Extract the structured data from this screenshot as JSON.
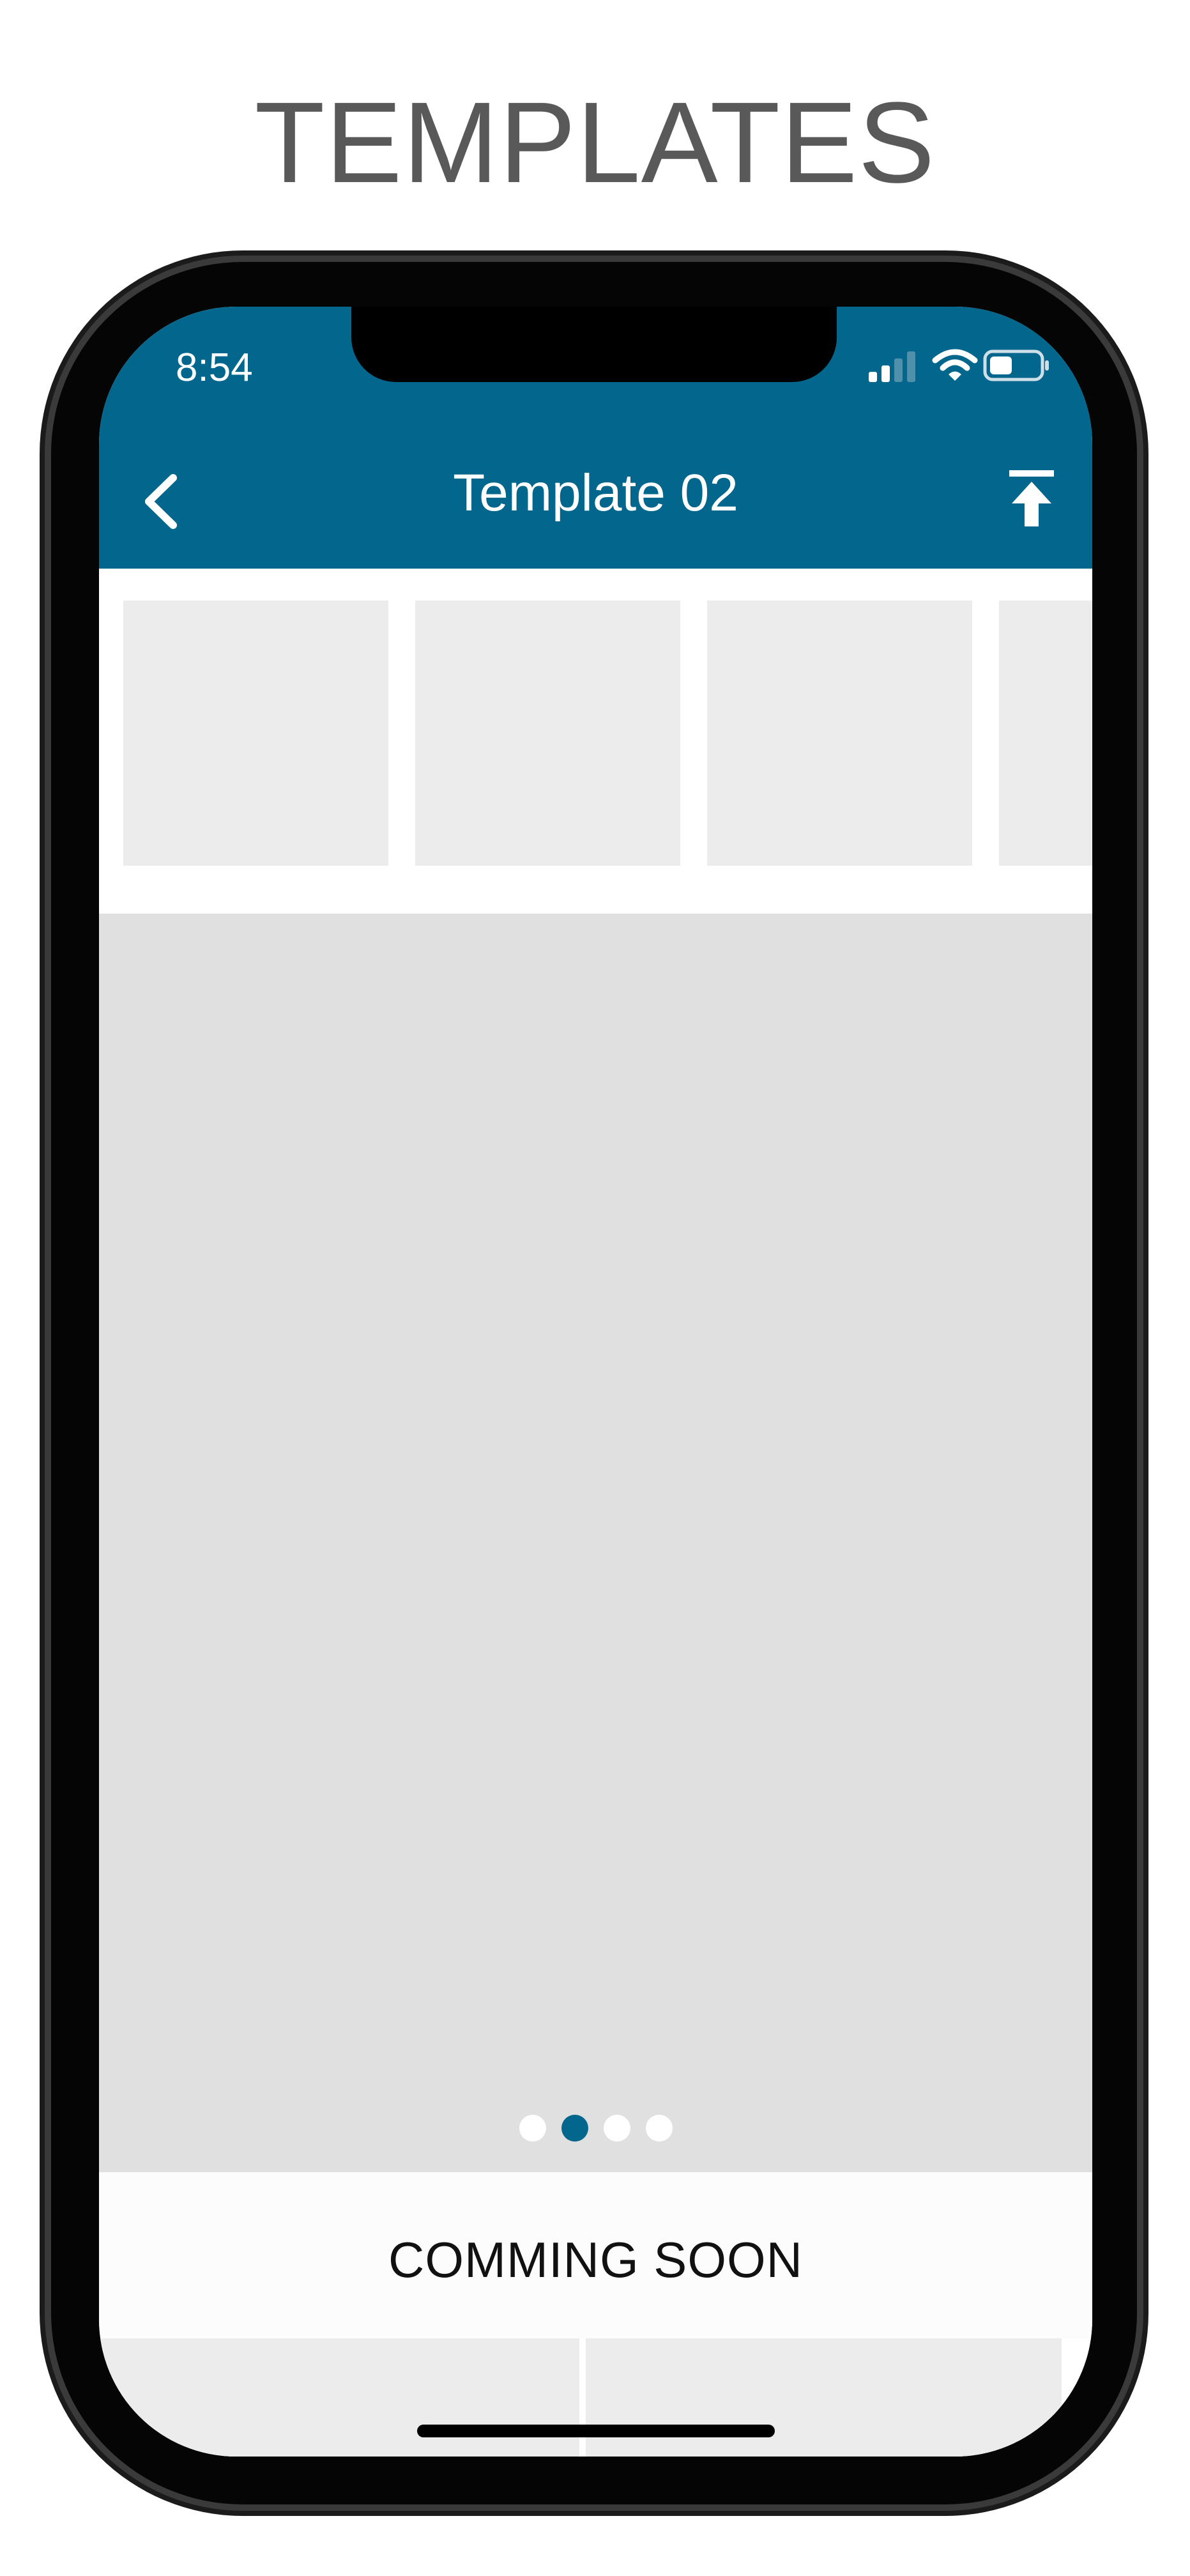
{
  "headline": "TEMPLATES",
  "status_bar": {
    "time": "8:54",
    "signal_icon": "cellular-signal-icon",
    "wifi_icon": "wifi-icon",
    "battery_icon": "battery-icon"
  },
  "nav_bar": {
    "title": "Template 02",
    "back_icon": "chevron-left-icon",
    "action_icon": "upload-to-top-icon"
  },
  "thumbnails": [
    {},
    {},
    {},
    {}
  ],
  "preview": {
    "page_count": 4,
    "active_page": 2
  },
  "coming_soon": {
    "label": "COMMING SOON"
  },
  "colors": {
    "header": "#03668c",
    "preview_bg": "#e0e0e0",
    "thumb_bg": "#ececec",
    "headline_text": "#595959"
  }
}
